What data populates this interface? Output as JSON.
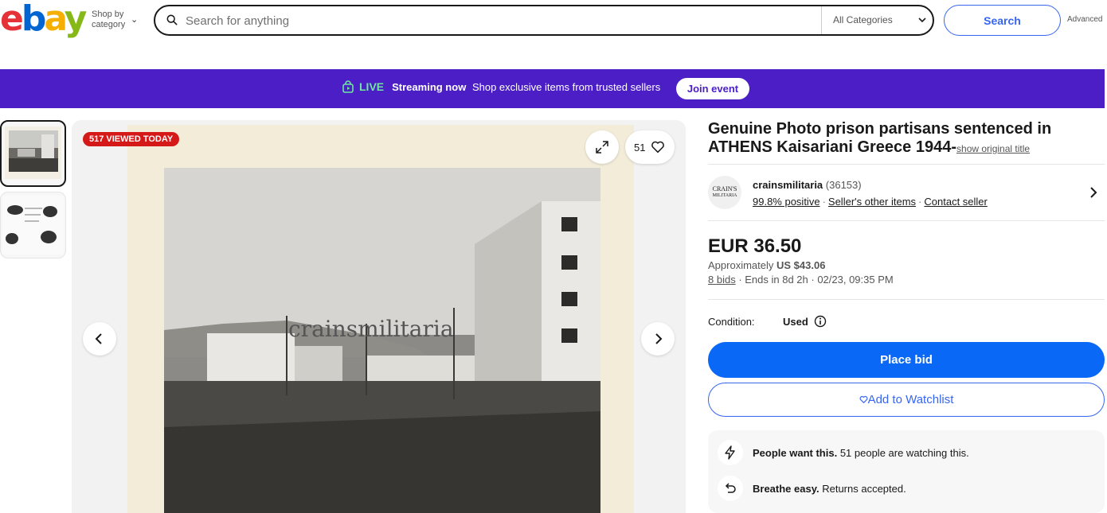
{
  "header": {
    "logo": {
      "e": "e",
      "b": "b",
      "a": "a",
      "y": "y"
    },
    "shop_by_line1": "Shop by",
    "shop_by_line2": "category",
    "search_placeholder": "Search for anything",
    "category_select": "All Categories",
    "search_button": "Search",
    "advanced": "Advanced"
  },
  "banner": {
    "live": "LIVE",
    "streaming": "Streaming now",
    "message": "Shop exclusive items from trusted sellers",
    "join_button": "Join event",
    "background_color": "#4b1ec6"
  },
  "gallery": {
    "viewed_badge": "517 VIEWED TODAY",
    "watch_count": "51",
    "watermark": "crainsmilitaria",
    "thumbnail_count": 2
  },
  "listing": {
    "title": "Genuine Photo prison partisans sentenced in ATHENS Kaisariani Greece 1944-",
    "show_original": "show original title",
    "seller": {
      "logo_line1": "CRAIN'S",
      "logo_line2": "MILITARIA",
      "name": "crainsmilitaria",
      "score": "(36153)",
      "positive": "99.8% positive",
      "other_items": "Seller's other items",
      "contact": "Contact seller"
    },
    "price": "EUR 36.50",
    "approx_label": "Approximately",
    "approx_value": "US $43.06",
    "bids": "8 bids",
    "ends": "Ends in 8d 2h · 02/23, 09:35 PM",
    "condition_label": "Condition:",
    "condition_value": "Used",
    "place_bid": "Place bid",
    "add_to_watchlist": "Add to Watchlist",
    "info": [
      {
        "bold": "People want this.",
        "text": "51 people are watching this.",
        "icon": "lightning-icon"
      },
      {
        "bold": "Breathe easy.",
        "text": "Returns accepted.",
        "icon": "return-arrow-icon"
      }
    ]
  },
  "colors": {
    "primary_blue": "#0968f6",
    "link_blue": "#3665f3",
    "badge_red": "#d51818"
  }
}
